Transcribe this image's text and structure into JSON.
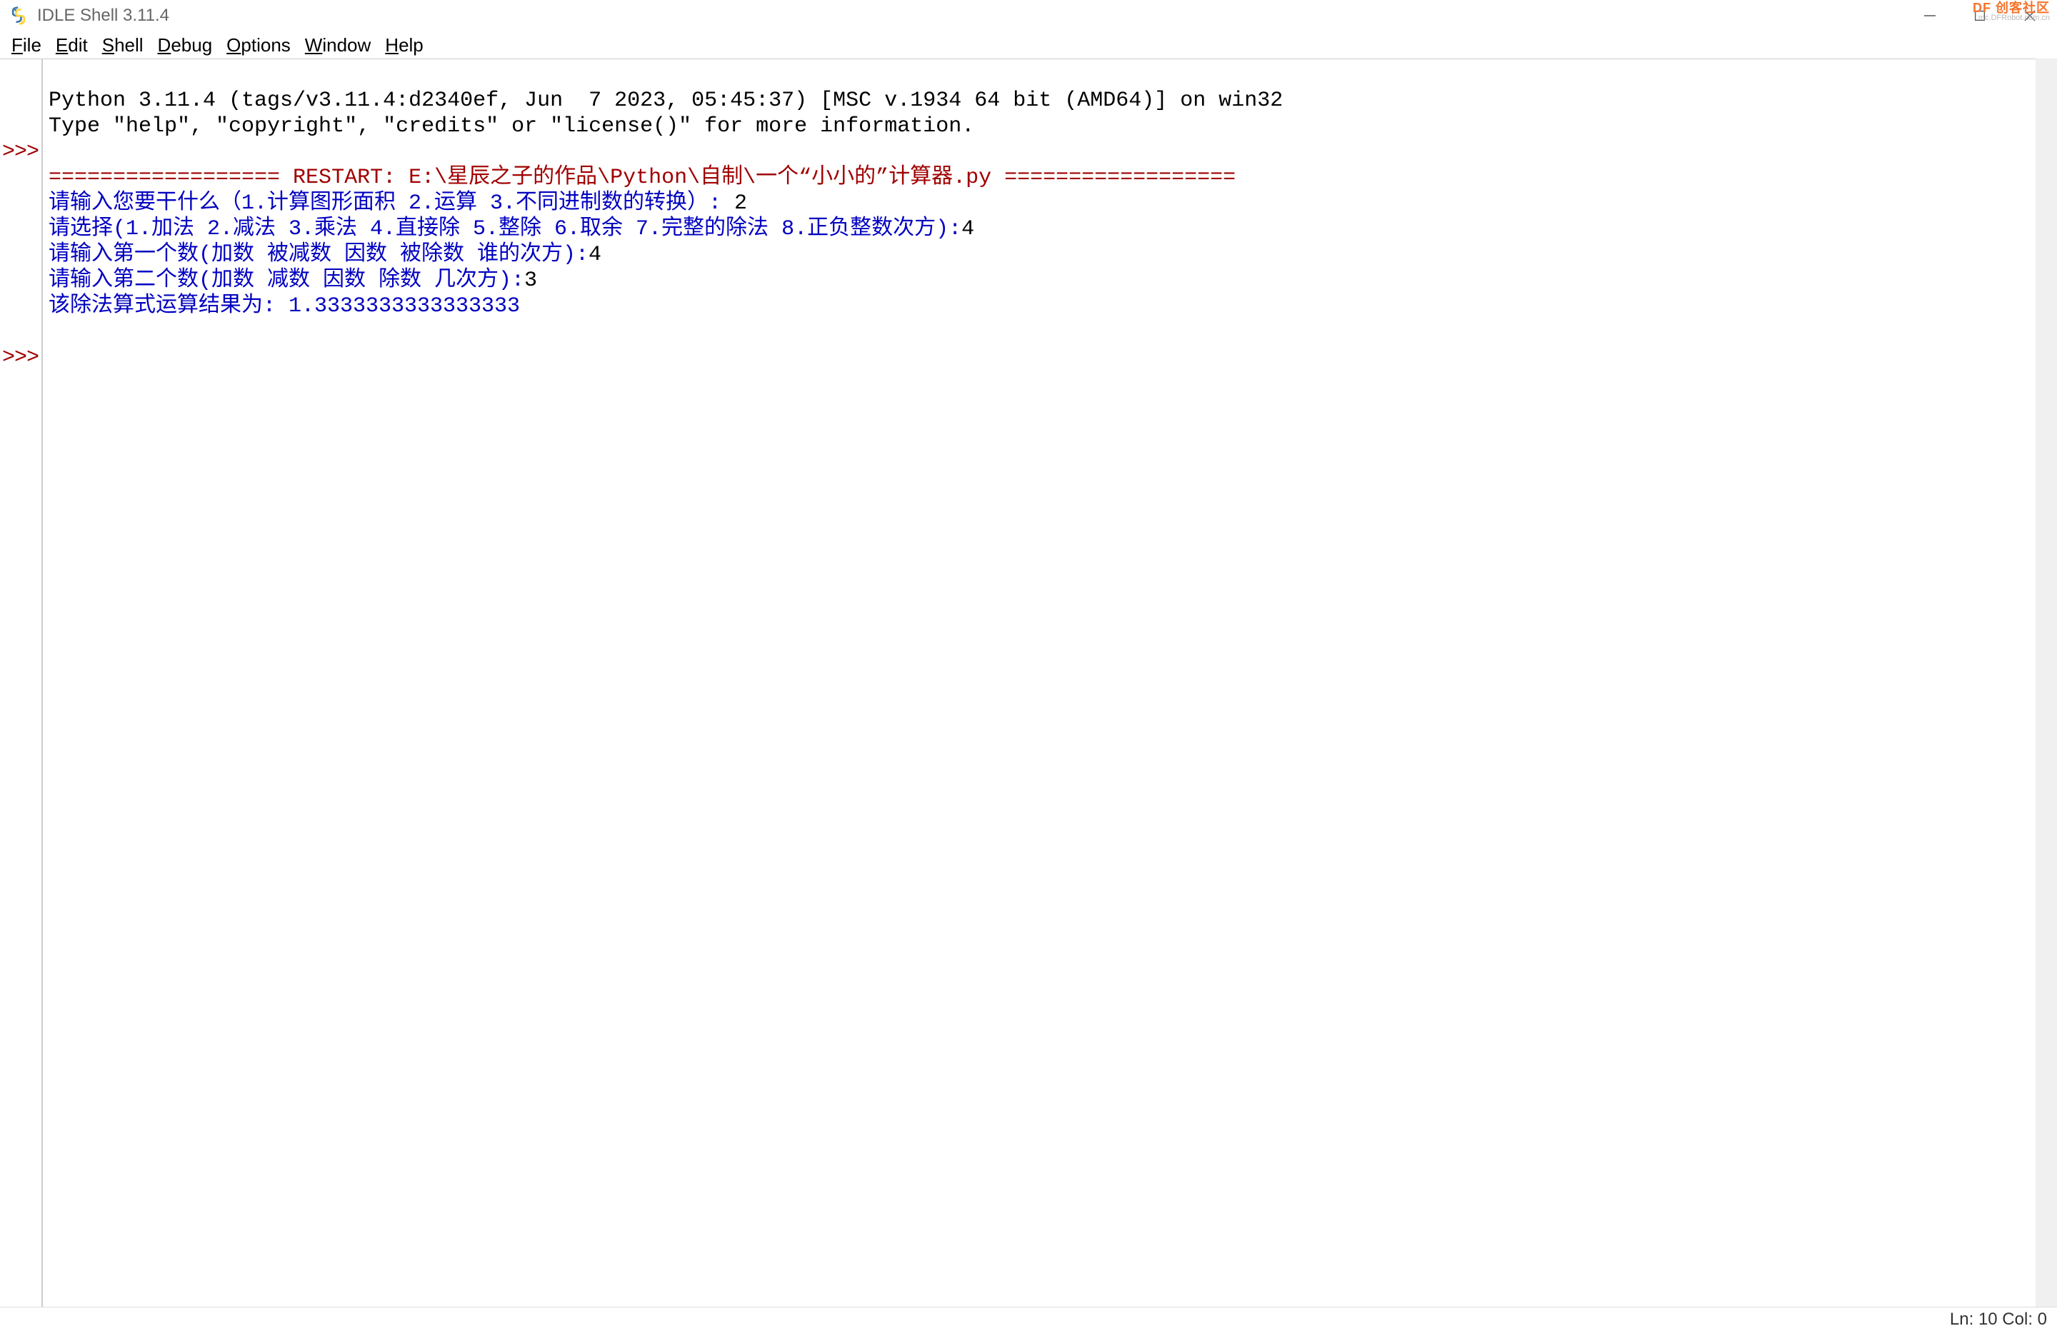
{
  "window": {
    "title": "IDLE Shell 3.11.4"
  },
  "menu": {
    "file": {
      "u": "F",
      "rest": "ile"
    },
    "edit": {
      "u": "E",
      "rest": "dit"
    },
    "shell": {
      "u": "S",
      "rest": "hell"
    },
    "debug": {
      "u": "D",
      "rest": "ebug"
    },
    "options": {
      "u": "O",
      "rest": "ptions"
    },
    "window": {
      "u": "W",
      "rest": "indow"
    },
    "help": {
      "u": "H",
      "rest": "elp"
    }
  },
  "gutter": {
    "l1": "",
    "l2": "",
    "l3": ">>>",
    "l4": "",
    "l5": "",
    "l6": "",
    "l7": "",
    "l8": "",
    "l9": "",
    "l10": ">>>"
  },
  "shell": {
    "banner1": "Python 3.11.4 (tags/v3.11.4:d2340ef, Jun  7 2023, 05:45:37) [MSC v.1934 64 bit (AMD64)] on win32",
    "banner2": "Type \"help\", \"copyright\", \"credits\" or \"license()\" for more information.",
    "restart": "================== RESTART: E:\\星辰之子的作品\\Python\\自制\\一个“小小的”计算器.py ==================",
    "p1_prompt": "请输入您要干什么（1.计算图形面积 2.运算 3.不同进制数的转换）: ",
    "p1_input": "2",
    "p2_prompt": "请选择(1.加法 2.减法 3.乘法 4.直接除 5.整除 6.取余 7.完整的除法 8.正负整数次方):",
    "p2_input": "4",
    "p3_prompt": "请输入第一个数(加数 被减数 因数 被除数 谁的次方):",
    "p3_input": "4",
    "p4_prompt": "请输入第二个数(加数 减数 因数 除数 几次方):",
    "p4_input": "3",
    "result": "该除法算式运算结果为: 1.3333333333333333"
  },
  "status": {
    "text": "Ln: 10  Col: 0"
  },
  "watermark": {
    "main": "DF 创客社区",
    "sub": "mc.DFRobot.com.cn"
  }
}
